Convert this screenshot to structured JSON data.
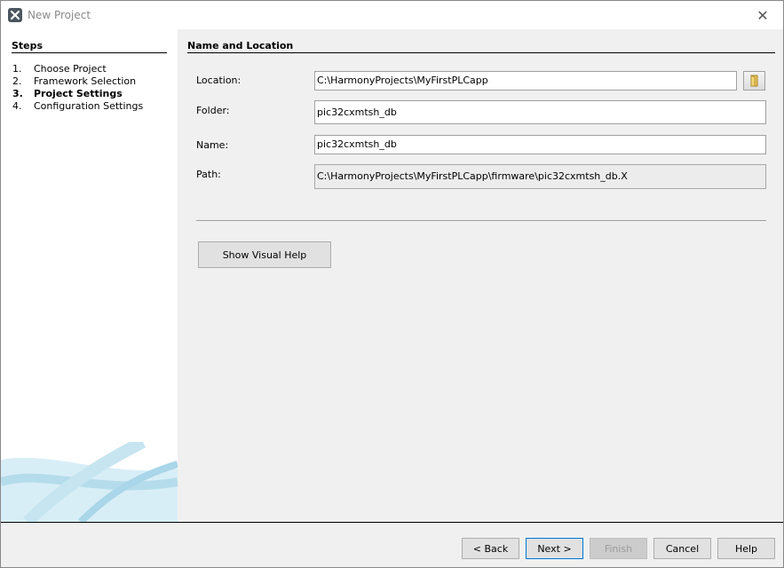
{
  "window": {
    "title": "New Project",
    "app_icon": "harmony-x-icon",
    "close_icon": "close-icon",
    "close_glyph": "✕"
  },
  "steps": {
    "title": "Steps",
    "items": [
      {
        "num": "1.",
        "label": "Choose Project"
      },
      {
        "num": "2.",
        "label": "Framework Selection"
      },
      {
        "num": "3.",
        "label": "Project Settings"
      },
      {
        "num": "4.",
        "label": "Configuration Settings"
      }
    ],
    "current_index": 2
  },
  "section": {
    "title": "Name and Location"
  },
  "fields": {
    "location": {
      "label": "Location:",
      "value": "C:\\HarmonyProjects\\MyFirstPLCapp"
    },
    "folder": {
      "label": "Folder:",
      "value": "pic32cxmtsh_db"
    },
    "name": {
      "label": "Name:",
      "value": "pic32cxmtsh_db"
    },
    "path": {
      "label": "Path:",
      "value": "C:\\HarmonyProjects\\MyFirstPLCapp\\firmware\\pic32cxmtsh_db.X"
    }
  },
  "browse_icon": "folder-icon",
  "visual_help_label": "Show Visual Help",
  "buttons": {
    "back": "< Back",
    "next": "Next >",
    "finish": "Finish",
    "cancel": "Cancel",
    "help": "Help"
  },
  "colors": {
    "accent": "#0078d7",
    "panel": "#ffffff",
    "background": "#f0f0f0"
  }
}
